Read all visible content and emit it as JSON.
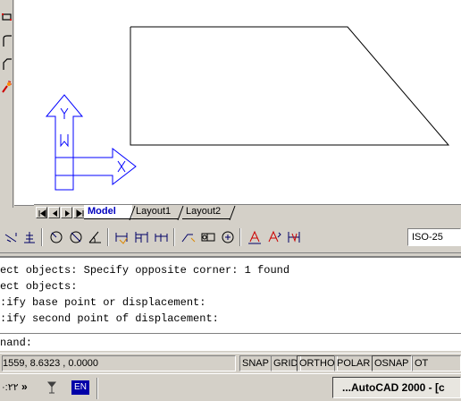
{
  "tabs": {
    "model": "Model",
    "layout1": "Layout1",
    "layout2": "Layout2"
  },
  "dimension_toolbar": {
    "style_value": "ISO-25"
  },
  "command_window": {
    "lines": [
      "ect objects: Specify opposite corner: 1 found",
      "ect objects:",
      ":ify base point or displacement:",
      ":ify second point of displacement:"
    ],
    "prompt": "nand:"
  },
  "status_bar": {
    "coordinates": "1559, 8.6323 , 0.0000",
    "buttons": [
      "SNAP",
      "GRID",
      "ORTHO",
      "POLAR",
      "OSNAP",
      "OT"
    ]
  },
  "taskbar": {
    "clock": "·:٢٢",
    "overflow": "»",
    "language": "EN",
    "task_title": "...AutoCAD 2000 - [c"
  },
  "ucs_icon": {
    "labels": [
      "Y",
      "W",
      "X"
    ],
    "color": "#0000ff"
  }
}
